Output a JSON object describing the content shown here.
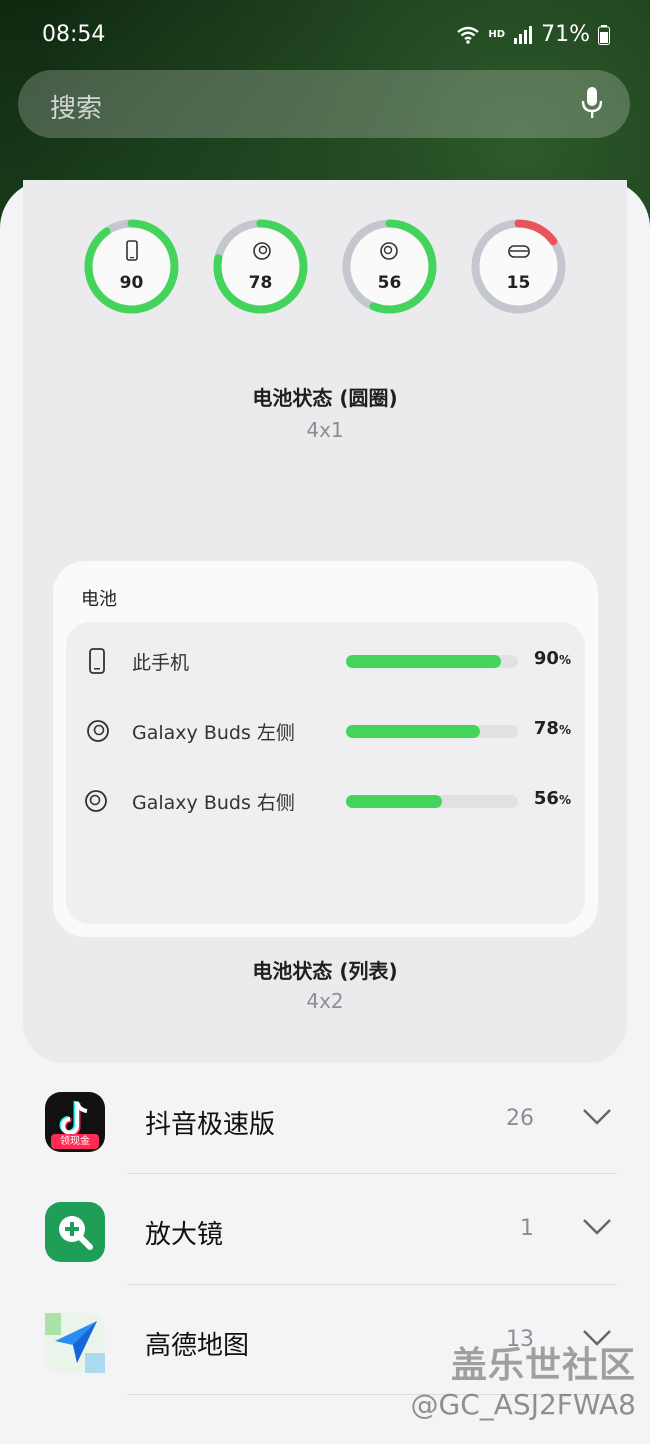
{
  "status_bar": {
    "time": "08:54",
    "hd_label": "HD",
    "battery": "71%"
  },
  "search": {
    "placeholder": "搜索",
    "mic_icon": "mic-icon"
  },
  "widgets": {
    "circle_widget": {
      "items": [
        {
          "icon": "phone-icon",
          "value": "90",
          "level": 0.9
        },
        {
          "icon": "bud-left-icon",
          "value": "78",
          "level": 0.78
        },
        {
          "icon": "bud-right-icon",
          "value": "56",
          "level": 0.56
        },
        {
          "icon": "case-icon",
          "value": "15",
          "level": 0.15
        }
      ],
      "title": "电池状态 (圆圈)",
      "size": "4x1"
    },
    "list_widget": {
      "header": "电池",
      "items": [
        {
          "icon": "phone-icon",
          "label": "此手机",
          "value": "90",
          "level": 0.9,
          "unit": "%"
        },
        {
          "icon": "bud-left-icon",
          "label": "Galaxy Buds 左侧",
          "value": "78",
          "level": 0.78,
          "unit": "%"
        },
        {
          "icon": "bud-right-icon",
          "label": "Galaxy Buds 右侧",
          "value": "56",
          "level": 0.56,
          "unit": "%"
        }
      ],
      "title": "电池状态 (列表)",
      "size": "4x2"
    }
  },
  "apps": [
    {
      "name": "抖音极速版",
      "count": "26",
      "icon_badge": "领现金"
    },
    {
      "name": "放大镜",
      "count": "1"
    },
    {
      "name": "高德地图",
      "count": "13"
    }
  ],
  "watermark": {
    "line1": "盖乐世社区",
    "line2": "@GC_ASJ2FWA8"
  },
  "colors": {
    "accent_green": "#44d45c",
    "low_red": "#e8545a",
    "ring_track": "#c5c7ce"
  }
}
